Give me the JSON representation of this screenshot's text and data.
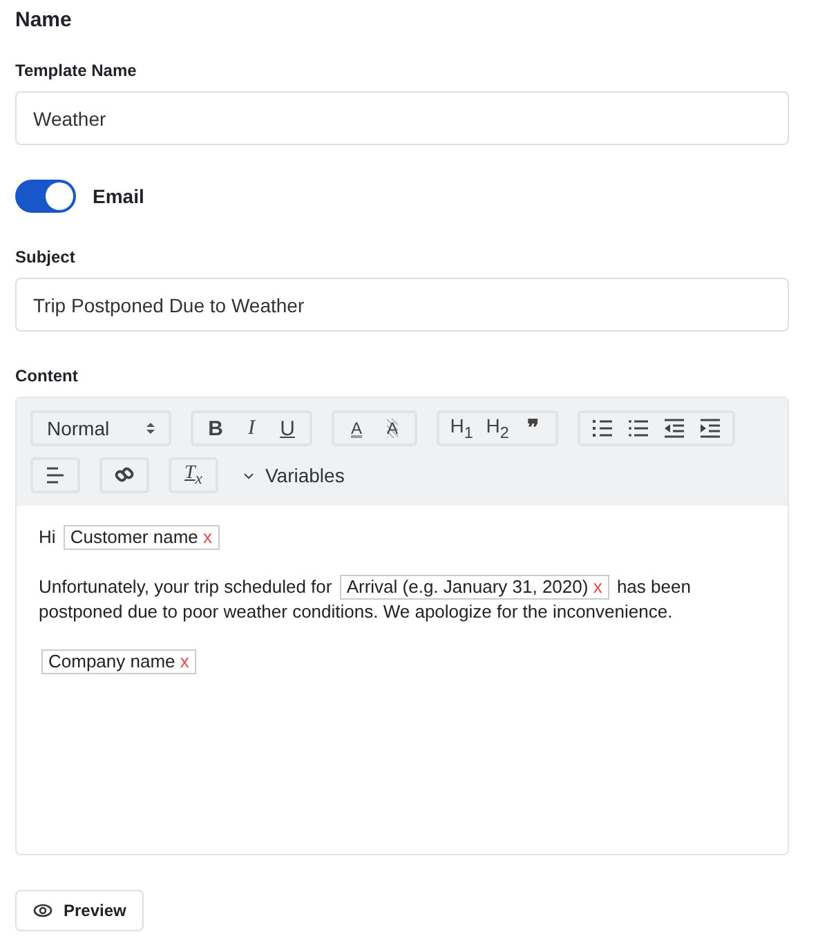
{
  "section_title": "Name",
  "template_name": {
    "label": "Template Name",
    "value": "Weather"
  },
  "email_toggle": {
    "label": "Email",
    "on": true
  },
  "subject": {
    "label": "Subject",
    "value": "Trip Postponed Due to Weather"
  },
  "content": {
    "label": "Content",
    "toolbar": [
      [
        {
          "kind": "select",
          "value": "Normal"
        }
      ],
      [
        {
          "kind": "bold",
          "label": "B"
        },
        {
          "kind": "italic",
          "label": "I"
        },
        {
          "kind": "underline",
          "label": "U"
        }
      ],
      [
        {
          "kind": "color",
          "label": "A"
        },
        {
          "kind": "background",
          "label": "A"
        }
      ],
      [
        {
          "kind": "header",
          "label": "H$_{1}$"
        },
        {
          "kind": "header",
          "label": "H$_{2}$"
        },
        {
          "kind": "blockquote",
          "label": "❞"
        }
      ],
      [
        {
          "kind": "ordered-list"
        },
        {
          "kind": "bullet-list"
        },
        {
          "kind": "outdent"
        },
        {
          "kind": "indent"
        }
      ],
      [
        {
          "kind": "align"
        }
      ],
      [
        {
          "kind": "link"
        }
      ],
      [
        {
          "kind": "clean",
          "label": "T$_{x}$"
        }
      ],
      [
        {
          "kind": "dropdown",
          "label": "Variables"
        }
      ]
    ],
    "paragraphs": [
      [
        {
          "kind": "text",
          "text": "Hi"
        },
        {
          "kind": "tag",
          "text": "Customer name",
          "remove": "x"
        }
      ],
      [
        {
          "kind": "text",
          "text": "Unfortunately, your trip scheduled for"
        },
        {
          "kind": "tag",
          "text": "Arrival (e.g. January 31, 2020)",
          "remove": "x"
        },
        {
          "kind": "text",
          "text": "has been postponed due to poor weather conditions. We apologize for the inconvenience."
        }
      ],
      [
        {
          "kind": "tag",
          "text": "Company name",
          "remove": "x"
        }
      ]
    ]
  },
  "preview_button": {
    "label": "Preview"
  }
}
